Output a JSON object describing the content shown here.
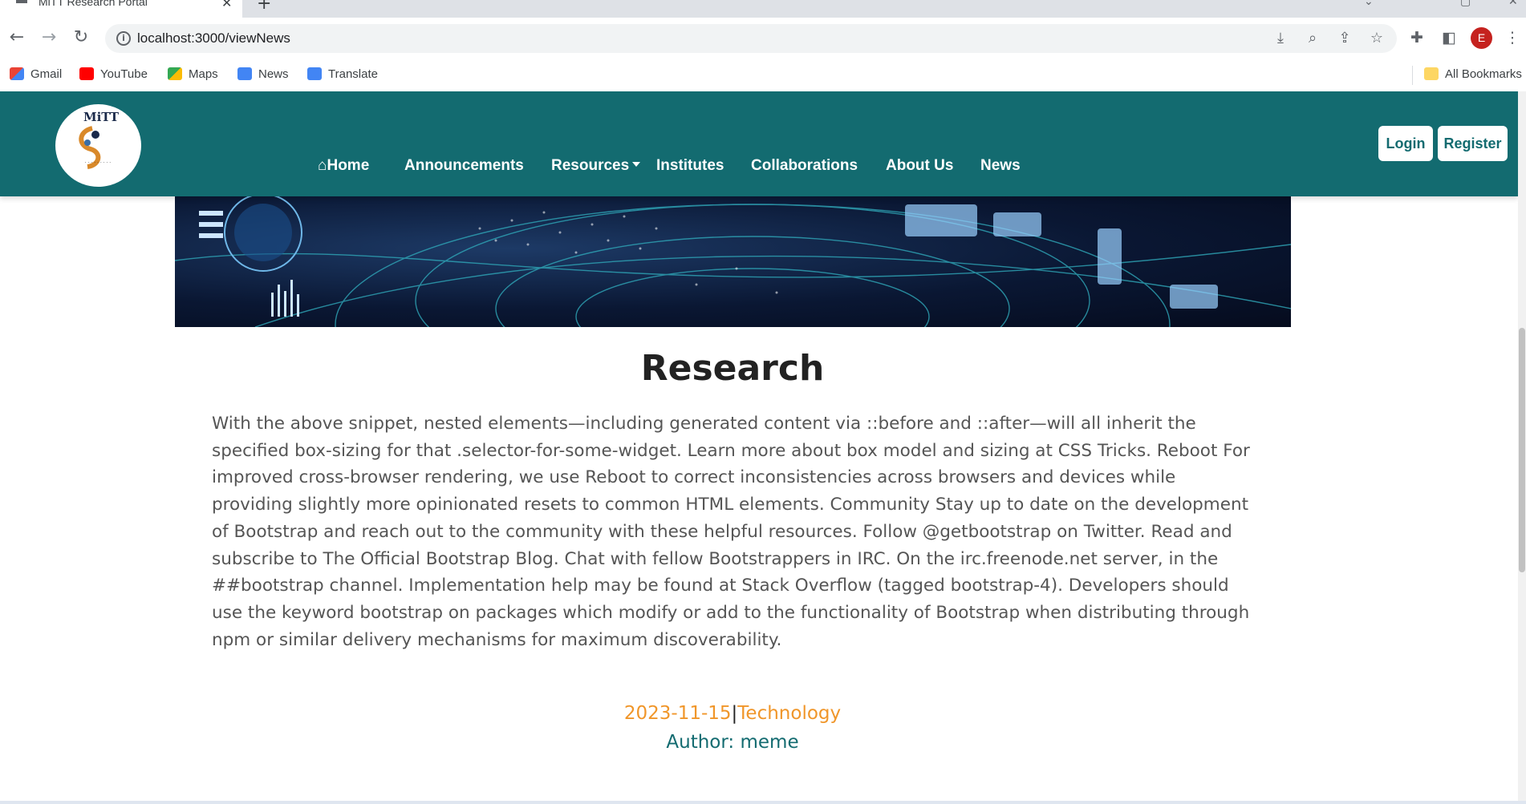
{
  "browser": {
    "tab_title": "MiTT Research Portal",
    "url": "localhost:3000/viewNews",
    "profile_initial": "E",
    "bookmarks": [
      "Gmail",
      "YouTube",
      "Maps",
      "News",
      "Translate"
    ],
    "all_bookmarks": "All Bookmarks"
  },
  "site": {
    "logo_text": "MiTT",
    "nav": {
      "home": "Home",
      "announcements": "Announcements",
      "resources": "Resources",
      "institutes": "Institutes",
      "collaborations": "Collaborations",
      "about": "About Us",
      "news": "News"
    },
    "login": "Login",
    "register": "Register"
  },
  "article": {
    "title": "Research",
    "body": "With the above snippet, nested elements—including generated content via ::before and ::after—will all inherit the specified box-sizing for that .selector-for-some-widget. Learn more about box model and sizing at CSS Tricks. Reboot For improved cross-browser rendering, we use Reboot to correct inconsistencies across browsers and devices while providing slightly more opinionated resets to common HTML elements. Community Stay up to date on the development of Bootstrap and reach out to the community with these helpful resources. Follow @getbootstrap on Twitter. Read and subscribe to The Official Bootstrap Blog. Chat with fellow Bootstrappers in IRC. On the irc.freenode.net server, in the ##bootstrap channel. Implementation help may be found at Stack Overflow (tagged bootstrap-4). Developers should use the keyword bootstrap on packages which modify or add to the functionality of Bootstrap when distributing through npm or similar delivery mechanisms for maximum discoverability.",
    "date": "2023-11-15",
    "separator": "|",
    "category": "Technology",
    "author": "Author: meme"
  },
  "colors": {
    "navbar": "#136b70",
    "accent": "#f0962a",
    "author": "#136b70"
  }
}
